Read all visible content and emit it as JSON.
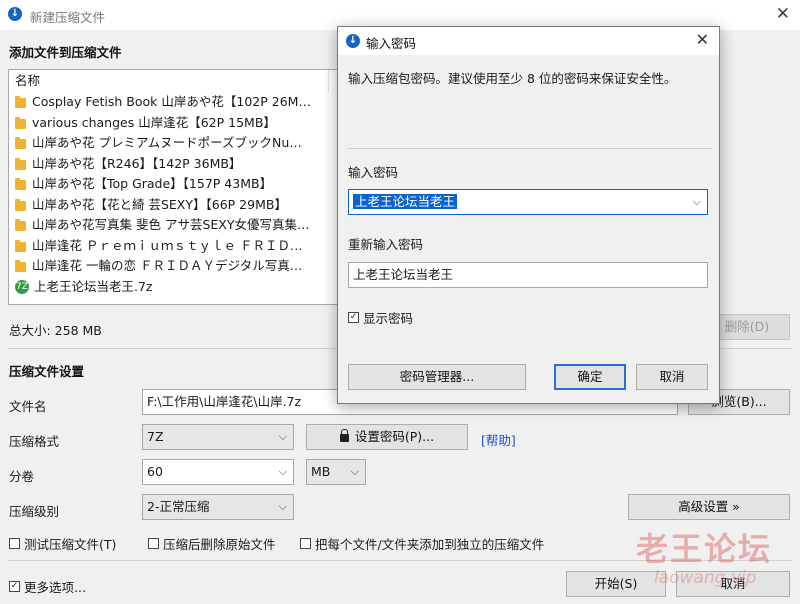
{
  "window": {
    "title": "新建压缩文件",
    "close_glyph": "✕"
  },
  "add_section": {
    "title": "添加文件到压缩文件",
    "column_name": "名称",
    "files": [
      "Cosplay Fetish Book 山岸あや花【102P 26M…",
      "various changes 山岸逢花【62P 15MB】",
      "山岸あや花 プレミアムヌードポーズブックNu…",
      "山岸あや花【R246】【142P 36MB】",
      "山岸あや花【Top Grade】【157P 43MB】",
      "山岸あや花【花と綺 芸SEXY】【66P 29MB】",
      "山岸あや花写真集 斐色 アサ芸SEXY女優写真集…",
      "山岸逢花 Ｐｒｅｍｉｕｍｓｔｙｌｅ ＦＲＩＤ…",
      "山岸逢花 一輪の恋 ＦＲＩＤＡＹデジタル写真…"
    ],
    "archive_item": "上老王论坛当老王.7z",
    "archive_icon_text": "7Z",
    "total_size": "总大小: 258 MB",
    "delete_button": "删除(D)"
  },
  "settings": {
    "title": "压缩文件设置",
    "filename_label": "文件名",
    "filename_value": "F:\\工作用\\山岸逢花\\山岸.7z",
    "browse_button": "浏览(B)...",
    "format_label": "压缩格式",
    "format_value": "7Z",
    "set_password_button": "设置密码(P)...",
    "help_link": "[帮助]",
    "split_label": "分卷",
    "split_value": "60",
    "split_unit": "MB",
    "level_label": "压缩级别",
    "level_value": "2-正常压缩",
    "advanced_button": "高级设置 »",
    "test_check": "测试压缩文件(T)",
    "delete_after_check": "压缩后删除原始文件",
    "separate_check": "把每个文件/文件夹添加到独立的压缩文件",
    "more_options_check": "更多选项...",
    "start_button": "开始(S)",
    "cancel_button": "取消"
  },
  "dialog": {
    "title": "输入密码",
    "description": "输入压缩包密码。建议使用至少 8 位的密码来保证安全性。",
    "password_label": "输入密码",
    "password_value": "上老王论坛当老王",
    "reenter_label": "重新输入密码",
    "reenter_value": "上老王论坛当老王",
    "show_password_check": "显示密码",
    "manager_button": "密码管理器...",
    "ok_button": "确定",
    "cancel_button": "取消"
  },
  "watermark": {
    "main": "老王论坛",
    "sub": "laowang.vip"
  },
  "icons": {
    "app": "archive-app-icon",
    "folder": "folder-icon",
    "archive": "7z-archive-icon",
    "lock": "lock-icon",
    "chevron": "chevron-down-icon"
  },
  "colors": {
    "accent": "#0a64d0",
    "link": "#1f4fd1",
    "folder": "#f0b232",
    "archive": "#2e9f47"
  }
}
